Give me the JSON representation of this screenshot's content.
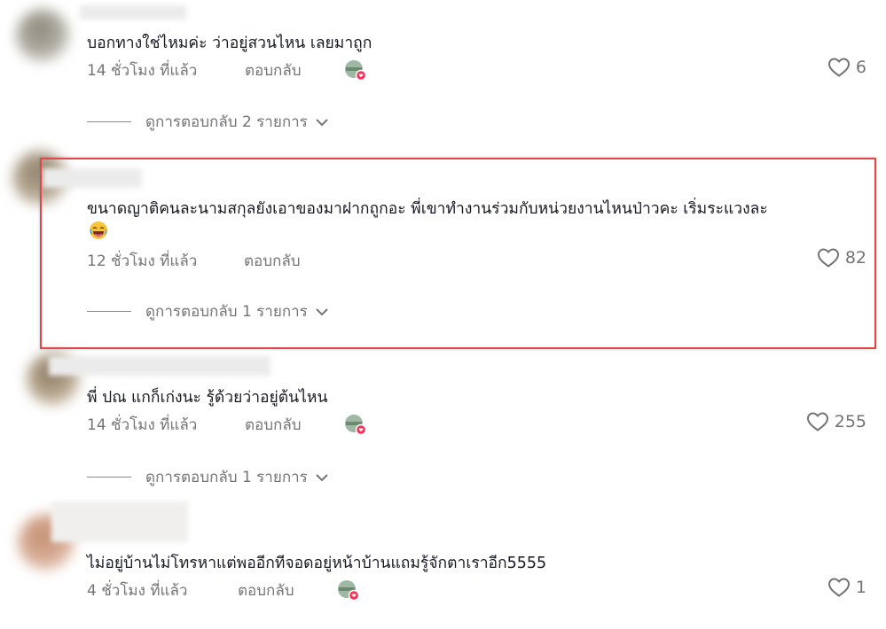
{
  "comments": [
    {
      "text": "บอกทางใช่ไหมค่ะ ว่าอยู่สวนไหน เลยมาถูก",
      "time": "14 ชั่วโมง ที่แล้ว",
      "reply": "ตอบกลับ",
      "creator_liked": true,
      "likes": "6",
      "view_replies": "ดูการตอบกลับ 2 รายการ"
    },
    {
      "text": "ขนาดญาติคนละนามสกุลยังเอาของมาฝากถูกอะ พี่เขาทำงานร่วมกับหน่วยงานไหนป่าวคะ เริ่มระแวงละ",
      "emoji": "laughing-emoji",
      "time": "12 ชั่วโมง ที่แล้ว",
      "reply": "ตอบกลับ",
      "creator_liked": false,
      "likes": "82",
      "view_replies": "ดูการตอบกลับ 1 รายการ",
      "highlighted": true,
      "highlight_color": "#e0464a"
    },
    {
      "text": "พี่ ปณ แกก็เก่งนะ รู้ด้วยว่าอยู่ต้นไหน",
      "time": "14 ชั่วโมง ที่แล้ว",
      "reply": "ตอบกลับ",
      "creator_liked": true,
      "likes": "255",
      "view_replies": "ดูการตอบกลับ 1 รายการ"
    },
    {
      "text": "ไม่อยู่บ้านไม่โทรหาแต่พออีกทีจอดอยู่หน้าบ้านแถมรู้จักตาเราอีก5555",
      "time": "4 ชั่วโมง ที่แล้ว",
      "reply": "ตอบกลับ",
      "creator_liked": true,
      "likes": "1"
    }
  ],
  "colors": {
    "text_primary": "#161823",
    "text_secondary": "#747476",
    "heart_badge": "#fe2c55"
  }
}
